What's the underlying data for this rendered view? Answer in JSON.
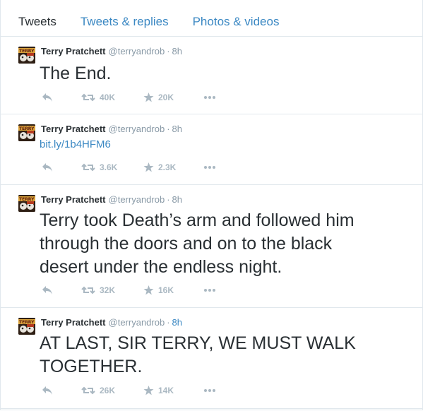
{
  "tabs": [
    {
      "label": "Tweets"
    },
    {
      "label": "Tweets & replies"
    },
    {
      "label": "Photos & videos"
    }
  ],
  "colors": {
    "link": "#3b88c3",
    "muted": "#8899a6",
    "action": "#aab8c2",
    "border": "#e1e8ed"
  },
  "tweets": [
    {
      "fullname": "Terry Pratchett",
      "username": "@terryandrob",
      "time": "8h",
      "text": "The End.",
      "retweets": "40K",
      "favorites": "20K"
    },
    {
      "fullname": "Terry Pratchett",
      "username": "@terryandrob",
      "time": "8h",
      "text": "bit.ly/1b4HFM6",
      "retweets": "3.6K",
      "favorites": "2.3K"
    },
    {
      "fullname": "Terry Pratchett",
      "username": "@terryandrob",
      "time": "8h",
      "text": "Terry took Death’s arm and followed him through the doors and on to the black desert under the endless night.",
      "retweets": "32K",
      "favorites": "16K"
    },
    {
      "fullname": "Terry Pratchett",
      "username": "@terryandrob",
      "time": "8h",
      "text": "AT LAST, SIR TERRY, WE MUST WALK TOGETHER.",
      "retweets": "26K",
      "favorites": "14K"
    }
  ],
  "icons": {
    "reply": "reply-icon",
    "retweet": "retweet-icon",
    "favorite": "star-icon",
    "more": "more-icon",
    "avatar": "avatar-image"
  }
}
